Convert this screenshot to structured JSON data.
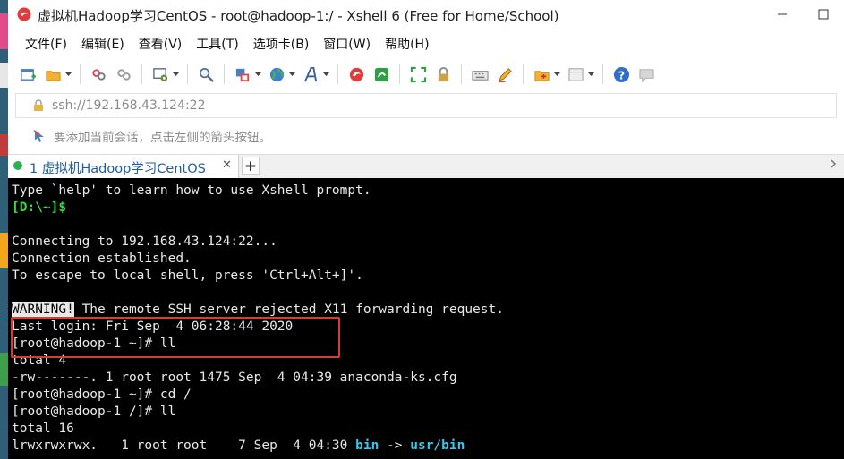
{
  "window": {
    "title": "虚拟机Hadoop学习CentOS - root@hadoop-1:/ - Xshell 6 (Free for Home/School)"
  },
  "menu": [
    "文件(F)",
    "编辑(E)",
    "查看(V)",
    "工具(T)",
    "选项卡(B)",
    "窗口(W)",
    "帮助(H)"
  ],
  "toolbar": {
    "icons": [
      "new-session-icon",
      "open-folder-icon",
      "reconnect-icon",
      "disconnect-icon",
      "properties-icon",
      "find-icon",
      "font-color-icon",
      "globe-icon",
      "font-icon",
      "xshell-logo-icon",
      "xftp-icon",
      "fullscreen-icon",
      "lock-icon",
      "keyboard-icon",
      "highlight-pen-icon",
      "transfer-folder-icon",
      "layout-icon",
      "help-icon",
      "chat-icon"
    ]
  },
  "address": {
    "value": "ssh://192.168.43.124:22"
  },
  "hint": {
    "text": "要添加当前会话，点击左侧的箭头按钮。"
  },
  "tabs": [
    {
      "label": "1 虚拟机Hadoop学习CentOS",
      "close": "✕"
    }
  ],
  "tab_add": "+",
  "terminal": {
    "lines": [
      {
        "segments": [
          {
            "text": "Type `help' to learn how to use Xshell prompt."
          }
        ]
      },
      {
        "segments": [
          {
            "text": "[D:\\~]$",
            "style": "green"
          }
        ]
      },
      {
        "segments": [
          {
            "text": ""
          }
        ]
      },
      {
        "segments": [
          {
            "text": "Connecting to 192.168.43.124:22..."
          }
        ]
      },
      {
        "segments": [
          {
            "text": "Connection established."
          }
        ]
      },
      {
        "segments": [
          {
            "text": "To escape to local shell, press 'Ctrl+Alt+]'."
          }
        ]
      },
      {
        "segments": [
          {
            "text": ""
          }
        ]
      },
      {
        "segments": [
          {
            "text": "WARNING!",
            "style": "inverse"
          },
          {
            "text": " The remote SSH server rejected X11 forwarding request."
          }
        ]
      },
      {
        "segments": [
          {
            "text": "Last login: Fri Sep  4 06:28:44 2020"
          }
        ]
      },
      {
        "segments": [
          {
            "text": "[root@hadoop-1 ~]# ll"
          }
        ]
      },
      {
        "segments": [
          {
            "text": "total 4"
          }
        ]
      },
      {
        "segments": [
          {
            "text": "-rw-------. 1 root root 1475 Sep  4 04:39 anaconda-ks.cfg"
          }
        ]
      },
      {
        "segments": [
          {
            "text": "[root@hadoop-1 ~]# cd /"
          }
        ]
      },
      {
        "segments": [
          {
            "text": "[root@hadoop-1 /]# ll"
          }
        ]
      },
      {
        "segments": [
          {
            "text": "total 16"
          }
        ]
      },
      {
        "segments": [
          {
            "text": "lrwxrwxrwx.   1 root root    7 Sep  4 04:30 "
          },
          {
            "text": "bin",
            "style": "cyan"
          },
          {
            "text": " -> "
          },
          {
            "text": "usr/bin",
            "style": "cyan"
          }
        ]
      }
    ]
  },
  "colors": {
    "terminal_bg": "#000000",
    "terminal_fg": "#e8e8e8",
    "prompt_green": "#3dd63d",
    "link_cyan": "#3ec6e8",
    "highlight_red": "#d93a3a",
    "tab_text": "#1f5fa0"
  }
}
